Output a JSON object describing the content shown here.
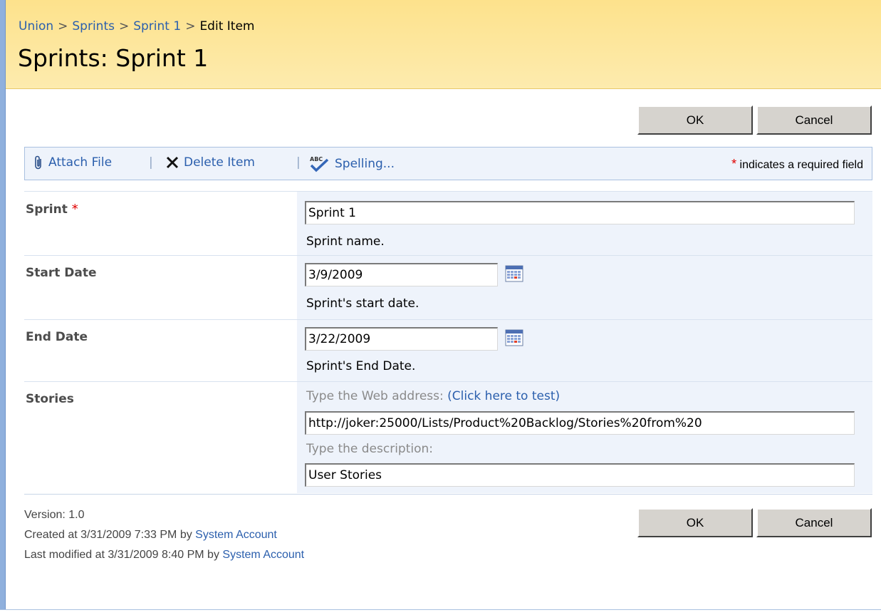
{
  "breadcrumb": {
    "items": [
      "Union",
      "Sprints",
      "Sprint 1"
    ],
    "current": "Edit Item",
    "separator": ">"
  },
  "page_title": "Sprints: Sprint 1",
  "buttons": {
    "ok": "OK",
    "cancel": "Cancel"
  },
  "toolbar": {
    "attach": "Attach File",
    "delete": "Delete Item",
    "spelling": "Spelling...",
    "separator": "|",
    "required_star": "*",
    "required_note": " indicates a required field"
  },
  "fields": {
    "sprint": {
      "label": "Sprint",
      "required_star": "*",
      "value": "Sprint 1",
      "help": "Sprint name."
    },
    "start_date": {
      "label": "Start Date",
      "value": "3/9/2009",
      "help": "Sprint's start date."
    },
    "end_date": {
      "label": "End Date",
      "value": "3/22/2009",
      "help": "Sprint's End Date."
    },
    "stories": {
      "label": "Stories",
      "url_hint": "Type the Web address: ",
      "test_link": "(Click here to test)",
      "url_value": "http://joker:25000/Lists/Product%20Backlog/Stories%20from%20",
      "desc_hint": "Type the description:",
      "desc_value": "User Stories"
    }
  },
  "meta": {
    "version": "Version: 1.0",
    "created_prefix": "Created at 3/31/2009 7:33 PM  by ",
    "created_by": "System Account",
    "modified_prefix": "Last modified at 3/31/2009 8:40 PM  by ",
    "modified_by": "System Account"
  },
  "colors": {
    "header_bg": "#fde28c",
    "link": "#2b5fad",
    "field_bg": "#eef3fb",
    "required": "#e00000"
  }
}
